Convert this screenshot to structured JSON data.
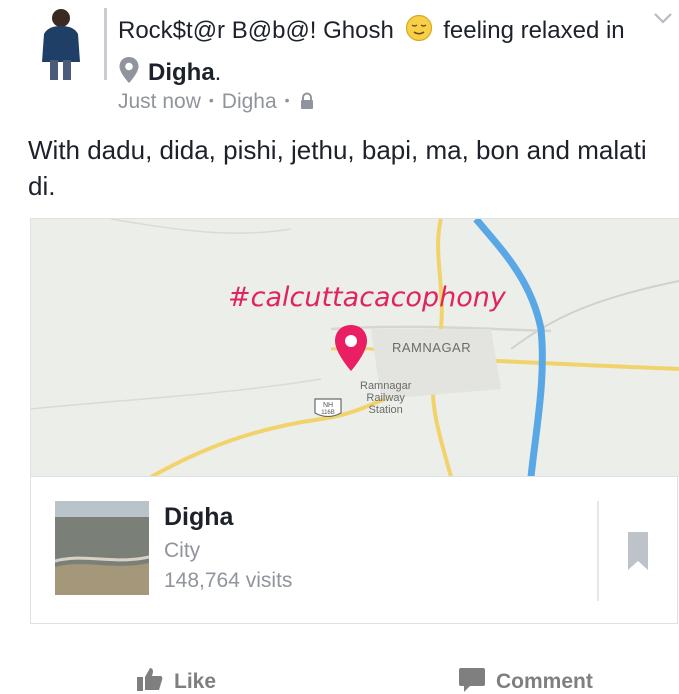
{
  "post": {
    "author": "Rock$t@r B@b@! Ghosh",
    "feeling_text": "feeling relaxed in",
    "place": "Digha",
    "place_suffix": ".",
    "timestamp": "Just now",
    "location": "Digha",
    "privacy_icon": "lock-icon",
    "text": "With dadu, dida,  pishi,  jethu,  bapi,  ma, bon and malati di.",
    "menu_icon": "chevron-down-icon",
    "feeling_icon": "relieved-face-emoji"
  },
  "map": {
    "hashtag": "#calcuttacacophony",
    "town_label": "RAMNAGAR",
    "station_label_1": "Ramnagar",
    "station_label_2": "Railway",
    "station_label_3": "Station",
    "highway_top": "NH",
    "highway_num": "116B",
    "marker_color": "#e91e63",
    "river_color": "#5aa7e6",
    "road_color": "#f2d36b"
  },
  "place_card": {
    "title": "Digha",
    "category": "City",
    "visits": "148,764 visits",
    "bookmark_icon": "bookmark-icon"
  },
  "actions": {
    "like": "Like",
    "comment": "Comment"
  }
}
